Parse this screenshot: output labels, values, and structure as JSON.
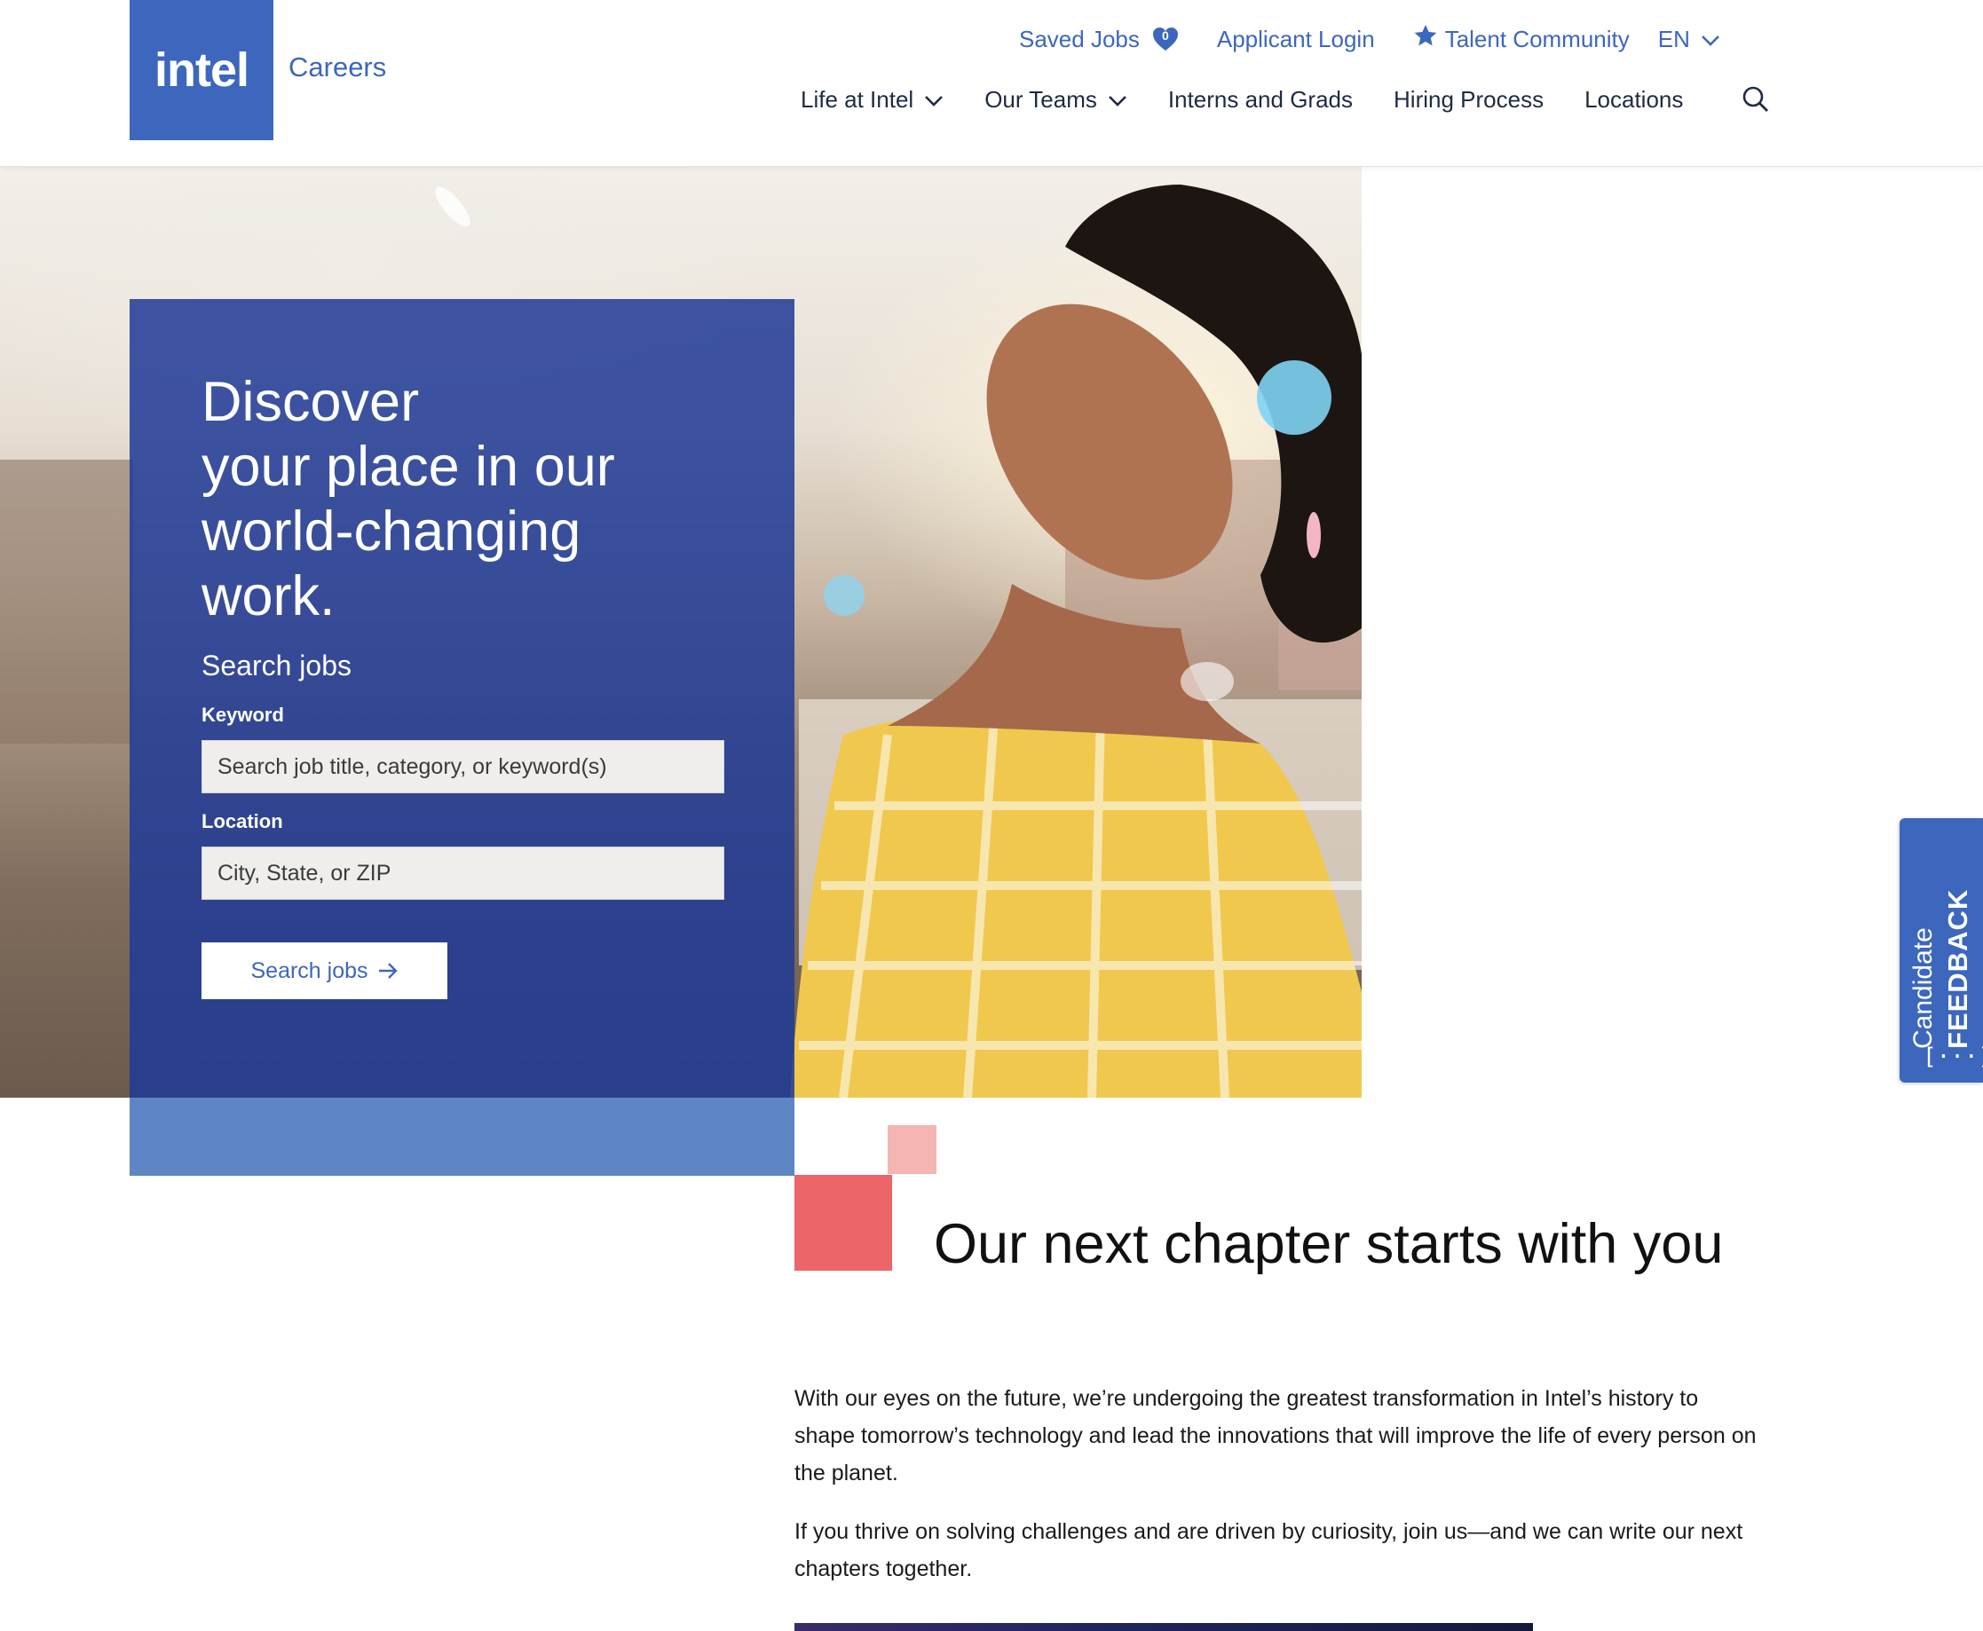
{
  "brand": {
    "logo_text": "intel",
    "site_label": "Careers",
    "logo_color": "#3c67bd"
  },
  "utility_nav": {
    "saved_jobs": "Saved Jobs",
    "saved_count": "0",
    "applicant_login": "Applicant Login",
    "talent_community": "Talent Community",
    "language": "EN"
  },
  "main_nav": {
    "items": [
      "Life at Intel",
      "Our Teams",
      "Interns and Grads",
      "Hiring Process",
      "Locations"
    ]
  },
  "hero": {
    "headline_1": "Discover",
    "headline_2": "your place in our",
    "headline_3": "world-changing",
    "headline_4": "work.",
    "search_title": "Search jobs",
    "keyword_label": "Keyword",
    "keyword_placeholder": "Search job title, category, or keyword(s)",
    "location_label": "Location",
    "location_placeholder": "City, State, or ZIP",
    "search_button": "Search jobs"
  },
  "feedback_tab": {
    "line1": "Candidate",
    "line2": "FEEDBACK",
    "icon": "[···]"
  },
  "content": {
    "title": "Our next chapter starts with you",
    "paragraph_1": "With our eyes on the future, we’re undergoing the greatest transformation in Intel’s history to shape tomorrow’s technology and lead the innovations that will improve the life of every person on the planet.",
    "paragraph_2": "If you thrive on solving challenges and are driven by curiosity, join us—and we can write our next chapters together."
  },
  "colors": {
    "brand_blue": "#3c67bd",
    "panel_blue": "#203a96",
    "accent_pink": "#eb6569",
    "accent_light_pink": "#f4b5b3"
  }
}
